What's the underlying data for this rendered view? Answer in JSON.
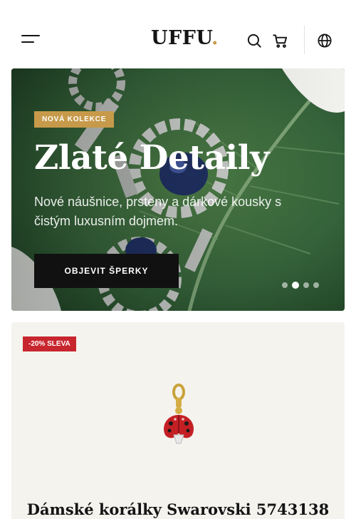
{
  "header": {
    "menu_icon": "hamburger-menu-icon",
    "logo_text": "UFFU",
    "logo_dot": ".",
    "search_icon": "search-icon",
    "cart_icon": "shopping-cart-icon",
    "language_icon": "globe-icon",
    "accent_color": "#c69a4a"
  },
  "hero": {
    "badge": "NOVÁ KOLEKCE",
    "title": "Zlaté Detaily",
    "subtitle": "Nové náušnice, prsteny a dárkové kousky s čistým luxusním dojmem.",
    "cta_label": "OBJEVIT ŠPERKY",
    "slides_count": 4,
    "active_slide": 2,
    "background_color": "#2f5a2e"
  },
  "product": {
    "sale_badge": "-20% SLEVA",
    "name": "Dámské korálky Swarovski 5743138",
    "image": "ladybug-charm-pendant",
    "sale_color": "#c8262e"
  }
}
